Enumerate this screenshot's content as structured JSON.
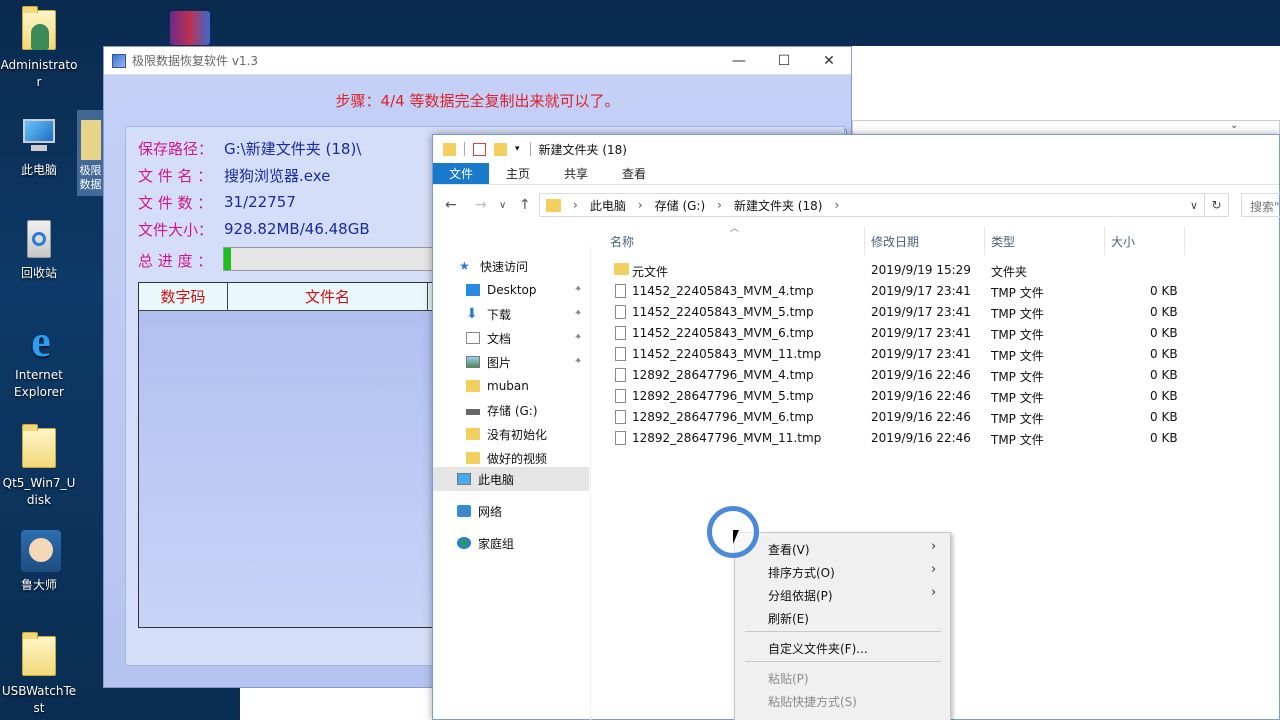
{
  "desktop": {
    "icons": [
      {
        "label": "Administrator",
        "icon": "user-folder-icon"
      },
      {
        "label": "此电脑",
        "icon": "computer-icon"
      },
      {
        "label": "回收站",
        "icon": "recycle-bin-icon"
      },
      {
        "label": "Internet Explorer",
        "icon": "ie-icon"
      },
      {
        "label": "Qt5_Win7_Udisk",
        "icon": "folder-icon"
      },
      {
        "label": "鲁大师",
        "icon": "ludashi-icon"
      },
      {
        "label": "USBWatchTest",
        "icon": "folder-icon"
      },
      {
        "label": "极限数据恢复软件",
        "icon": "app-icon"
      }
    ]
  },
  "recovery_app": {
    "title": "极限数据恢复软件 v1.3",
    "step_text": "步骤：4/4 等数据完全复制出来就可以了。",
    "save_path_label": "保存路径：",
    "save_path_value": "G:\\新建文件夹 (18)\\",
    "file_name_label": "文 件 名 ：",
    "file_name_value": "搜狗浏览器.exe",
    "file_count_label": "文 件 数 ：",
    "file_count_value": "31/22757",
    "file_size_label": "文件大小：",
    "file_size_value": "928.82MB/46.48GB",
    "progress_label": "总 进 度 ：",
    "progress_fraction": 0.03,
    "table_headers": [
      "数字码",
      "文件名"
    ],
    "colors": {
      "label": "#d0168c",
      "value": "#1a2aa0",
      "step": "#e0202a",
      "progress": "#1ec01e"
    }
  },
  "explorer": {
    "window_title": "新建文件夹 (18)",
    "ribbon_tabs": [
      "文件",
      "主页",
      "共享",
      "查看"
    ],
    "breadcrumb": [
      "此电脑",
      "存储 (G:)",
      "新建文件夹 (18)"
    ],
    "search_placeholder": "搜索\"新",
    "nav_items": [
      {
        "label": "快速访问",
        "icon": "star-icon"
      },
      {
        "label": "Desktop",
        "icon": "desktop-icon"
      },
      {
        "label": "下载",
        "icon": "download-icon"
      },
      {
        "label": "文档",
        "icon": "document-icon"
      },
      {
        "label": "图片",
        "icon": "picture-icon"
      },
      {
        "label": "muban",
        "icon": "folder-icon"
      },
      {
        "label": "存储 (G:)",
        "icon": "drive-icon"
      },
      {
        "label": "没有初始化",
        "icon": "folder-icon"
      },
      {
        "label": "做好的视频",
        "icon": "folder-icon"
      },
      {
        "label": "此电脑",
        "icon": "computer-icon"
      },
      {
        "label": "网络",
        "icon": "network-icon"
      },
      {
        "label": "家庭组",
        "icon": "homegroup-icon"
      }
    ],
    "columns": [
      "名称",
      "修改日期",
      "类型",
      "大小"
    ],
    "files": [
      {
        "name": "元文件",
        "date": "2019/9/19 15:29",
        "type": "文件夹",
        "size": ""
      },
      {
        "name": "11452_22405843_MVM_4.tmp",
        "date": "2019/9/17 23:41",
        "type": "TMP 文件",
        "size": "0 KB"
      },
      {
        "name": "11452_22405843_MVM_5.tmp",
        "date": "2019/9/17 23:41",
        "type": "TMP 文件",
        "size": "0 KB"
      },
      {
        "name": "11452_22405843_MVM_6.tmp",
        "date": "2019/9/17 23:41",
        "type": "TMP 文件",
        "size": "0 KB"
      },
      {
        "name": "11452_22405843_MVM_11.tmp",
        "date": "2019/9/17 23:41",
        "type": "TMP 文件",
        "size": "0 KB"
      },
      {
        "name": "12892_28647796_MVM_4.tmp",
        "date": "2019/9/16 22:46",
        "type": "TMP 文件",
        "size": "0 KB"
      },
      {
        "name": "12892_28647796_MVM_5.tmp",
        "date": "2019/9/16 22:46",
        "type": "TMP 文件",
        "size": "0 KB"
      },
      {
        "name": "12892_28647796_MVM_6.tmp",
        "date": "2019/9/16 22:46",
        "type": "TMP 文件",
        "size": "0 KB"
      },
      {
        "name": "12892_28647796_MVM_11.tmp",
        "date": "2019/9/16 22:46",
        "type": "TMP 文件",
        "size": "0 KB"
      }
    ]
  },
  "context_menu": {
    "items": [
      {
        "label": "查看(V)",
        "submenu": true,
        "disabled": false
      },
      {
        "label": "排序方式(O)",
        "submenu": true,
        "disabled": false
      },
      {
        "label": "分组依据(P)",
        "submenu": true,
        "disabled": false
      },
      {
        "label": "刷新(E)",
        "submenu": false,
        "disabled": false
      },
      {
        "label": "自定义文件夹(F)...",
        "submenu": false,
        "disabled": false
      },
      {
        "label": "粘贴(P)",
        "submenu": false,
        "disabled": true
      },
      {
        "label": "粘贴快捷方式(S)",
        "submenu": false,
        "disabled": true
      }
    ]
  }
}
